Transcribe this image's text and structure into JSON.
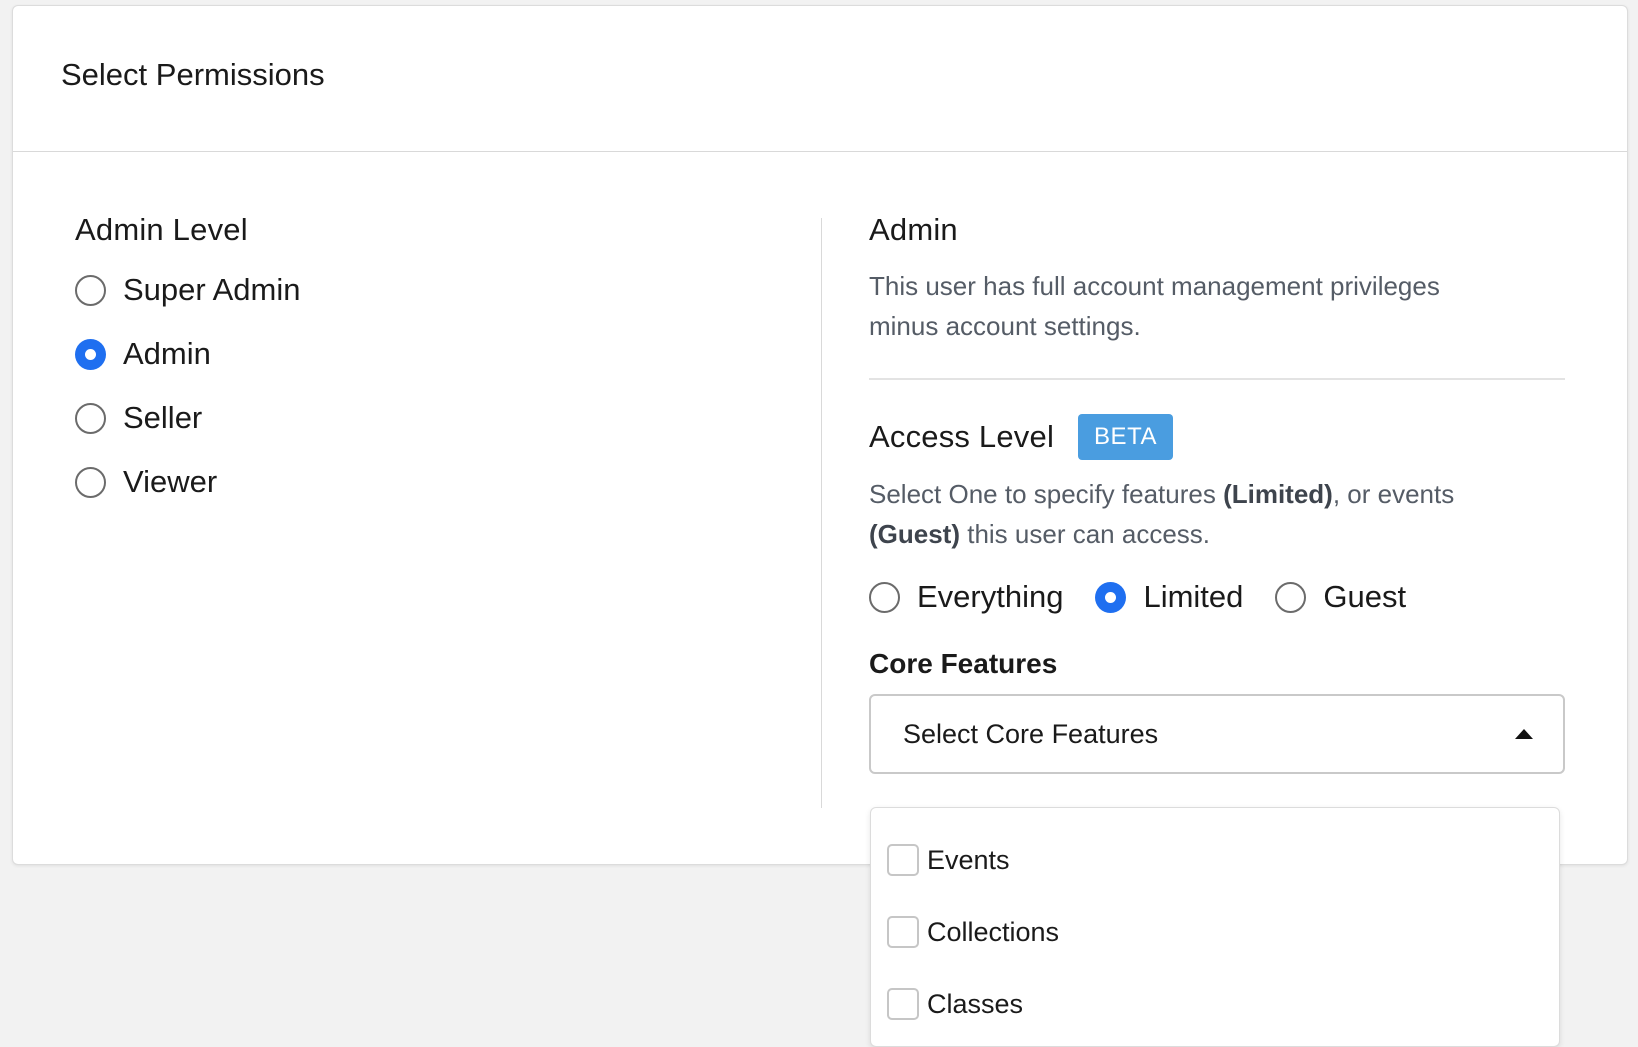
{
  "card": {
    "title": "Select Permissions"
  },
  "admin_level": {
    "label": "Admin Level",
    "options": [
      {
        "label": "Super Admin",
        "checked": false
      },
      {
        "label": "Admin",
        "checked": true
      },
      {
        "label": "Seller",
        "checked": false
      },
      {
        "label": "Viewer",
        "checked": false
      }
    ]
  },
  "role_detail": {
    "title": "Admin",
    "description": "This user has full account management privileges minus account settings."
  },
  "access_level": {
    "label": "Access Level",
    "badge": "BETA",
    "desc_part1": "Select One to specify features ",
    "desc_bold1": "(Limited)",
    "desc_part2": ", or events ",
    "desc_bold2": "(Guest)",
    "desc_part3": " this user can access.",
    "options": [
      {
        "label": "Everything",
        "checked": false
      },
      {
        "label": "Limited",
        "checked": true
      },
      {
        "label": "Guest",
        "checked": false
      }
    ]
  },
  "core_features": {
    "label": "Core Features",
    "select_placeholder": "Select Core Features",
    "items": [
      {
        "label": "Events",
        "checked": false
      },
      {
        "label": "Collections",
        "checked": false
      },
      {
        "label": "Classes",
        "checked": false
      }
    ]
  },
  "colors": {
    "accent": "#1f6ff0",
    "badge": "#4a9de0",
    "background": "#f2f2f2"
  }
}
